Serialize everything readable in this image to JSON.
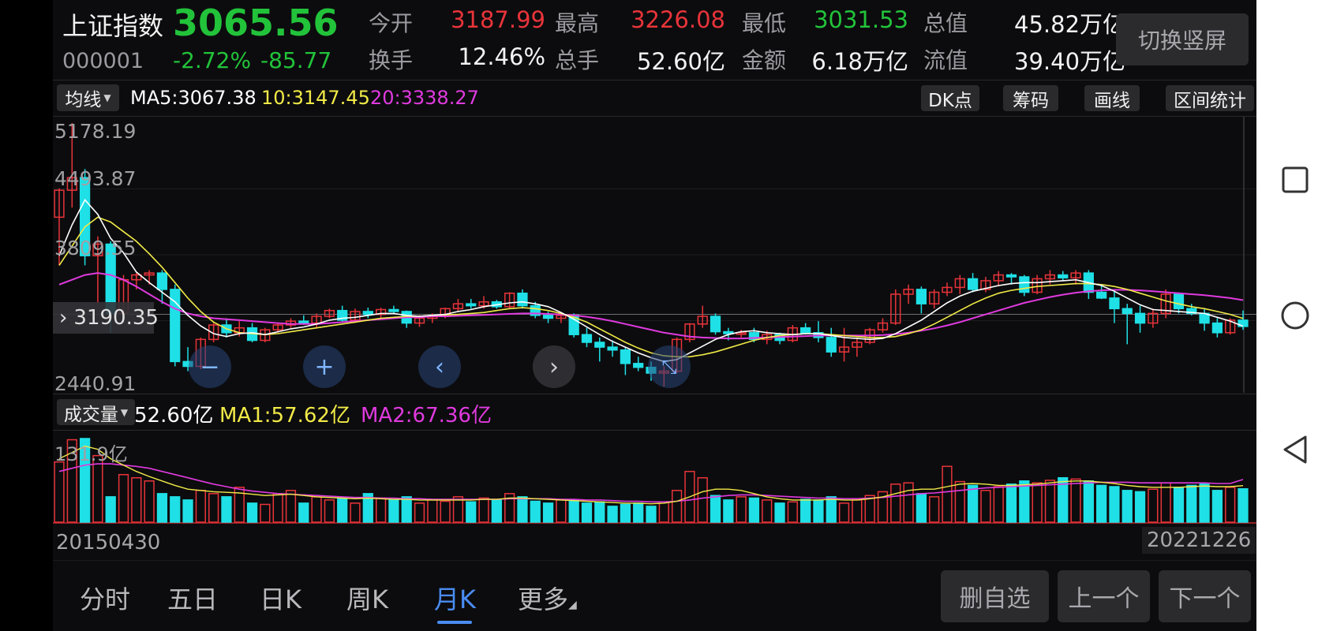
{
  "header": {
    "index_name": "上证指数",
    "price": "3065.56",
    "code": "000001",
    "change_pct": "-2.72%",
    "change_val": "-85.77",
    "stats": [
      {
        "label": "今开",
        "value": "3187.99",
        "color": "red"
      },
      {
        "label": "最高",
        "value": "3226.08",
        "color": "red"
      },
      {
        "label": "最低",
        "value": "3031.53",
        "color": "green"
      },
      {
        "label": "总值",
        "value": "45.82万亿",
        "color": "white"
      },
      {
        "label": "换手",
        "value": "12.46%",
        "color": "white"
      },
      {
        "label": "总手",
        "value": "52.60亿",
        "color": "white"
      },
      {
        "label": "金额",
        "value": "6.18万亿",
        "color": "white"
      },
      {
        "label": "流值",
        "value": "39.40万亿",
        "color": "white"
      }
    ],
    "switch_label": "切换竖屏"
  },
  "ma_bar": {
    "selector_label": "均线",
    "ma5": "MA5:3067.38",
    "ma10": "10:3147.45",
    "ma20": "20:3338.27",
    "tools": [
      "DK点",
      "筹码",
      "画线",
      "区间统计"
    ]
  },
  "price_axis": {
    "labels": [
      "5178.19",
      "4493.87",
      "3809.55",
      "2440.91"
    ],
    "crosshair_value": "3190.35"
  },
  "volume_bar": {
    "selector_label": "成交量",
    "value": "52.60亿",
    "ma1": "MA1:57.62亿",
    "ma2": "MA2:67.36亿",
    "axis_label": "131.9亿"
  },
  "dates": {
    "start": "20150430",
    "end": "20221226"
  },
  "controls": [
    "−",
    "+",
    "‹",
    "›",
    "⤡"
  ],
  "tabs": [
    {
      "label": "分时",
      "active": false
    },
    {
      "label": "五日",
      "active": false
    },
    {
      "label": "日K",
      "active": false
    },
    {
      "label": "周K",
      "active": false
    },
    {
      "label": "月K",
      "active": true
    },
    {
      "label": "更多",
      "active": false
    }
  ],
  "bottom_buttons": [
    "删自选",
    "上一个",
    "下一个"
  ],
  "colors": {
    "up": "#e8343a",
    "down": "#1fe0e6",
    "ma5": "#ffffff",
    "ma10": "#f1ea47",
    "ma20": "#e03adf",
    "accent": "#4a8cf2"
  },
  "chart_data": {
    "type": "candlestick",
    "ylim": [
      2440.91,
      5178.19
    ],
    "candles": [
      {
        "o": 4200,
        "h": 4500,
        "l": 3700,
        "c": 4480
      },
      {
        "o": 4480,
        "h": 5178,
        "l": 4300,
        "c": 4611
      },
      {
        "o": 4611,
        "h": 4700,
        "l": 3700,
        "c": 3800
      },
      {
        "o": 3800,
        "h": 4000,
        "l": 3300,
        "c": 3920
      },
      {
        "o": 3920,
        "h": 3950,
        "l": 3000,
        "c": 3200
      },
      {
        "o": 3200,
        "h": 3600,
        "l": 3100,
        "c": 3550
      },
      {
        "o": 3550,
        "h": 3620,
        "l": 3450,
        "c": 3600
      },
      {
        "o": 3600,
        "h": 3650,
        "l": 3500,
        "c": 3620
      },
      {
        "o": 3620,
        "h": 3650,
        "l": 3300,
        "c": 3450
      },
      {
        "o": 3450,
        "h": 3500,
        "l": 2650,
        "c": 2700
      },
      {
        "o": 2700,
        "h": 2850,
        "l": 2600,
        "c": 2650
      },
      {
        "o": 2650,
        "h": 2950,
        "l": 2620,
        "c": 2930
      },
      {
        "o": 2930,
        "h": 3100,
        "l": 2900,
        "c": 3080
      },
      {
        "o": 3080,
        "h": 3150,
        "l": 2950,
        "c": 3000
      },
      {
        "o": 3000,
        "h": 3120,
        "l": 2960,
        "c": 3050
      },
      {
        "o": 3050,
        "h": 3100,
        "l": 2900,
        "c": 2920
      },
      {
        "o": 2920,
        "h": 3050,
        "l": 2900,
        "c": 3030
      },
      {
        "o": 3030,
        "h": 3100,
        "l": 3000,
        "c": 3080
      },
      {
        "o": 3080,
        "h": 3150,
        "l": 3050,
        "c": 3120
      },
      {
        "o": 3120,
        "h": 3180,
        "l": 3080,
        "c": 3100
      },
      {
        "o": 3100,
        "h": 3200,
        "l": 3050,
        "c": 3170
      },
      {
        "o": 3170,
        "h": 3250,
        "l": 3150,
        "c": 3230
      },
      {
        "o": 3230,
        "h": 3280,
        "l": 3100,
        "c": 3130
      },
      {
        "o": 3130,
        "h": 3250,
        "l": 3100,
        "c": 3220
      },
      {
        "o": 3220,
        "h": 3260,
        "l": 3150,
        "c": 3190
      },
      {
        "o": 3190,
        "h": 3260,
        "l": 3150,
        "c": 3240
      },
      {
        "o": 3240,
        "h": 3280,
        "l": 3200,
        "c": 3220
      },
      {
        "o": 3220,
        "h": 3230,
        "l": 3050,
        "c": 3100
      },
      {
        "o": 3100,
        "h": 3180,
        "l": 3060,
        "c": 3150
      },
      {
        "o": 3150,
        "h": 3200,
        "l": 3100,
        "c": 3170
      },
      {
        "o": 3170,
        "h": 3260,
        "l": 3150,
        "c": 3250
      },
      {
        "o": 3250,
        "h": 3350,
        "l": 3220,
        "c": 3300
      },
      {
        "o": 3300,
        "h": 3350,
        "l": 3250,
        "c": 3280
      },
      {
        "o": 3280,
        "h": 3380,
        "l": 3250,
        "c": 3320
      },
      {
        "o": 3320,
        "h": 3340,
        "l": 3250,
        "c": 3270
      },
      {
        "o": 3270,
        "h": 3420,
        "l": 3250,
        "c": 3410
      },
      {
        "o": 3410,
        "h": 3450,
        "l": 3250,
        "c": 3280
      },
      {
        "o": 3280,
        "h": 3320,
        "l": 3150,
        "c": 3180
      },
      {
        "o": 3180,
        "h": 3220,
        "l": 3100,
        "c": 3150
      },
      {
        "o": 3150,
        "h": 3200,
        "l": 3100,
        "c": 3180
      },
      {
        "o": 3180,
        "h": 3200,
        "l": 2950,
        "c": 2980
      },
      {
        "o": 2980,
        "h": 3050,
        "l": 2850,
        "c": 2900
      },
      {
        "o": 2900,
        "h": 2950,
        "l": 2700,
        "c": 2850
      },
      {
        "o": 2850,
        "h": 2920,
        "l": 2750,
        "c": 2820
      },
      {
        "o": 2820,
        "h": 2850,
        "l": 2560,
        "c": 2680
      },
      {
        "o": 2680,
        "h": 2750,
        "l": 2600,
        "c": 2640
      },
      {
        "o": 2640,
        "h": 2700,
        "l": 2500,
        "c": 2580
      },
      {
        "o": 2580,
        "h": 2650,
        "l": 2440,
        "c": 2600
      },
      {
        "o": 2600,
        "h": 2950,
        "l": 2580,
        "c": 2930
      },
      {
        "o": 2930,
        "h": 3100,
        "l": 2900,
        "c": 3090
      },
      {
        "o": 3090,
        "h": 3280,
        "l": 3050,
        "c": 3170
      },
      {
        "o": 3170,
        "h": 3200,
        "l": 2980,
        "c": 3010
      },
      {
        "o": 3010,
        "h": 3050,
        "l": 2920,
        "c": 2990
      },
      {
        "o": 2990,
        "h": 3030,
        "l": 2950,
        "c": 3000
      },
      {
        "o": 3000,
        "h": 3050,
        "l": 2900,
        "c": 2930
      },
      {
        "o": 2930,
        "h": 3020,
        "l": 2880,
        "c": 2980
      },
      {
        "o": 2980,
        "h": 3000,
        "l": 2880,
        "c": 2920
      },
      {
        "o": 2920,
        "h": 3080,
        "l": 2900,
        "c": 3050
      },
      {
        "o": 3050,
        "h": 3100,
        "l": 2980,
        "c": 3000
      },
      {
        "o": 3000,
        "h": 3120,
        "l": 2900,
        "c": 2950
      },
      {
        "o": 2950,
        "h": 3050,
        "l": 2750,
        "c": 2800
      },
      {
        "o": 2800,
        "h": 3050,
        "l": 2700,
        "c": 2850
      },
      {
        "o": 2850,
        "h": 2950,
        "l": 2750,
        "c": 2900
      },
      {
        "o": 2900,
        "h": 3050,
        "l": 2880,
        "c": 3030
      },
      {
        "o": 3030,
        "h": 3150,
        "l": 3000,
        "c": 3100
      },
      {
        "o": 3100,
        "h": 3450,
        "l": 3080,
        "c": 3400
      },
      {
        "o": 3400,
        "h": 3500,
        "l": 3300,
        "c": 3450
      },
      {
        "o": 3450,
        "h": 3480,
        "l": 3200,
        "c": 3300
      },
      {
        "o": 3300,
        "h": 3450,
        "l": 3250,
        "c": 3420
      },
      {
        "o": 3420,
        "h": 3520,
        "l": 3380,
        "c": 3470
      },
      {
        "o": 3470,
        "h": 3600,
        "l": 3400,
        "c": 3560
      },
      {
        "o": 3560,
        "h": 3620,
        "l": 3420,
        "c": 3450
      },
      {
        "o": 3450,
        "h": 3580,
        "l": 3420,
        "c": 3540
      },
      {
        "o": 3540,
        "h": 3640,
        "l": 3480,
        "c": 3600
      },
      {
        "o": 3600,
        "h": 3620,
        "l": 3500,
        "c": 3580
      },
      {
        "o": 3580,
        "h": 3600,
        "l": 3380,
        "c": 3420
      },
      {
        "o": 3420,
        "h": 3600,
        "l": 3400,
        "c": 3560
      },
      {
        "o": 3560,
        "h": 3650,
        "l": 3500,
        "c": 3600
      },
      {
        "o": 3600,
        "h": 3640,
        "l": 3540,
        "c": 3570
      },
      {
        "o": 3570,
        "h": 3650,
        "l": 3500,
        "c": 3620
      },
      {
        "o": 3620,
        "h": 3650,
        "l": 3350,
        "c": 3420
      },
      {
        "o": 3420,
        "h": 3500,
        "l": 3350,
        "c": 3360
      },
      {
        "o": 3360,
        "h": 3450,
        "l": 3100,
        "c": 3250
      },
      {
        "o": 3250,
        "h": 3300,
        "l": 2880,
        "c": 3200
      },
      {
        "o": 3200,
        "h": 3280,
        "l": 3000,
        "c": 3100
      },
      {
        "o": 3100,
        "h": 3250,
        "l": 3050,
        "c": 3200
      },
      {
        "o": 3200,
        "h": 3450,
        "l": 3150,
        "c": 3400
      },
      {
        "o": 3400,
        "h": 3420,
        "l": 3200,
        "c": 3250
      },
      {
        "o": 3250,
        "h": 3300,
        "l": 3180,
        "c": 3200
      },
      {
        "o": 3200,
        "h": 3250,
        "l": 3020,
        "c": 3100
      },
      {
        "o": 3100,
        "h": 3150,
        "l": 2950,
        "c": 3000
      },
      {
        "o": 3000,
        "h": 3150,
        "l": 2980,
        "c": 3130
      },
      {
        "o": 3130,
        "h": 3230,
        "l": 3030,
        "c": 3065
      }
    ],
    "ma5": [
      3800,
      4120,
      4380,
      4230,
      3980,
      3830,
      3630,
      3520,
      3420,
      3320,
      3180,
      3070,
      2990,
      2960,
      2990,
      3000,
      2980,
      3010,
      3040,
      3060,
      3090,
      3130,
      3150,
      3160,
      3180,
      3200,
      3200,
      3180,
      3170,
      3180,
      3190,
      3220,
      3240,
      3270,
      3290,
      3310,
      3320,
      3300,
      3270,
      3210,
      3140,
      3060,
      2980,
      2910,
      2850,
      2790,
      2740,
      2700,
      2720,
      2790,
      2860,
      2930,
      2980,
      3010,
      3020,
      3000,
      2990,
      2980,
      2990,
      2990,
      2970,
      2950,
      2940,
      2930,
      2940,
      2990,
      3060,
      3130,
      3220,
      3310,
      3380,
      3430,
      3460,
      3490,
      3510,
      3520,
      3520,
      3530,
      3540,
      3550,
      3520,
      3490,
      3430,
      3360,
      3290,
      3240,
      3230,
      3220,
      3210,
      3200,
      3160,
      3120,
      3067
    ],
    "ma10": [
      3700,
      3900,
      4100,
      4200,
      4150,
      4050,
      3950,
      3820,
      3680,
      3520,
      3360,
      3220,
      3110,
      3040,
      3000,
      2990,
      2980,
      2990,
      3010,
      3030,
      3050,
      3070,
      3090,
      3110,
      3130,
      3150,
      3160,
      3170,
      3170,
      3180,
      3185,
      3190,
      3200,
      3210,
      3230,
      3250,
      3260,
      3250,
      3230,
      3200,
      3160,
      3110,
      3040,
      2970,
      2900,
      2840,
      2790,
      2760,
      2750,
      2750,
      2770,
      2800,
      2840,
      2880,
      2920,
      2950,
      2970,
      2980,
      2990,
      2990,
      2980,
      2970,
      2960,
      2950,
      2950,
      2960,
      2990,
      3030,
      3090,
      3160,
      3230,
      3300,
      3360,
      3410,
      3440,
      3460,
      3480,
      3490,
      3500,
      3510,
      3510,
      3500,
      3480,
      3450,
      3410,
      3370,
      3330,
      3300,
      3270,
      3250,
      3220,
      3190,
      3147
    ],
    "ma20": [
      3500,
      3550,
      3600,
      3620,
      3600,
      3550,
      3480,
      3400,
      3320,
      3250,
      3200,
      3170,
      3150,
      3140,
      3130,
      3120,
      3110,
      3100,
      3090,
      3090,
      3090,
      3100,
      3110,
      3120,
      3130,
      3140,
      3150,
      3160,
      3160,
      3170,
      3170,
      3175,
      3180,
      3185,
      3190,
      3195,
      3200,
      3200,
      3195,
      3190,
      3180,
      3165,
      3145,
      3120,
      3090,
      3060,
      3030,
      3000,
      2980,
      2960,
      2950,
      2945,
      2940,
      2940,
      2945,
      2950,
      2955,
      2960,
      2965,
      2970,
      2970,
      2970,
      2970,
      2970,
      2975,
      2985,
      3000,
      3020,
      3045,
      3075,
      3110,
      3150,
      3190,
      3230,
      3270,
      3310,
      3340,
      3370,
      3395,
      3415,
      3430,
      3440,
      3445,
      3445,
      3440,
      3430,
      3420,
      3410,
      3400,
      3390,
      3375,
      3360,
      3338
    ],
    "volume": [
      95,
      130,
      131.9,
      105,
      40,
      75,
      70,
      65,
      45,
      40,
      35,
      50,
      45,
      40,
      55,
      30,
      28,
      45,
      50,
      30,
      40,
      35,
      38,
      30,
      45,
      38,
      35,
      40,
      30,
      35,
      33,
      40,
      32,
      38,
      35,
      45,
      40,
      33,
      30,
      35,
      35,
      30,
      32,
      25,
      28,
      30,
      25,
      32,
      50,
      80,
      70,
      42,
      35,
      40,
      38,
      35,
      30,
      32,
      36,
      35,
      40,
      30,
      35,
      42,
      48,
      60,
      62,
      45,
      40,
      88,
      64,
      58,
      50,
      56,
      60,
      65,
      62,
      66,
      70,
      68,
      65,
      58,
      56,
      50,
      48,
      52,
      62,
      55,
      58,
      60,
      50,
      55,
      52.6
    ],
    "vol_ma1": [
      100,
      110,
      120,
      115,
      100,
      90,
      80,
      72,
      65,
      58,
      52,
      50,
      48,
      47,
      46,
      44,
      42,
      43,
      44,
      42,
      40,
      39,
      38,
      37,
      38,
      37,
      36,
      36,
      35,
      35,
      35,
      35,
      35,
      36,
      36,
      38,
      38,
      37,
      36,
      35,
      34,
      33,
      32,
      31,
      30,
      30,
      29,
      30,
      33,
      40,
      48,
      52,
      52,
      50,
      45,
      40,
      37,
      35,
      35,
      35,
      36,
      35,
      35,
      37,
      40,
      45,
      50,
      52,
      52,
      56,
      60,
      61,
      60,
      58,
      58,
      59,
      60,
      62,
      64,
      65,
      65,
      63,
      61,
      58,
      56,
      55,
      55,
      55,
      56,
      57,
      56,
      56,
      57.6
    ],
    "vol_ma2": [
      80,
      85,
      90,
      92,
      92,
      90,
      88,
      85,
      80,
      75,
      70,
      65,
      60,
      56,
      52,
      49,
      47,
      45,
      44,
      43,
      42,
      41,
      40,
      39,
      39,
      38,
      38,
      37,
      37,
      36,
      36,
      36,
      36,
      36,
      36,
      37,
      37,
      37,
      37,
      36,
      36,
      35,
      35,
      34,
      33,
      33,
      32,
      32,
      33,
      35,
      38,
      40,
      42,
      43,
      43,
      42,
      41,
      40,
      39,
      38,
      38,
      37,
      37,
      38,
      39,
      41,
      43,
      45,
      46,
      48,
      50,
      52,
      54,
      55,
      56,
      57,
      58,
      59,
      60,
      61,
      62,
      63,
      63,
      63,
      62,
      62,
      62,
      62,
      62,
      62,
      61,
      61,
      67.36
    ]
  }
}
